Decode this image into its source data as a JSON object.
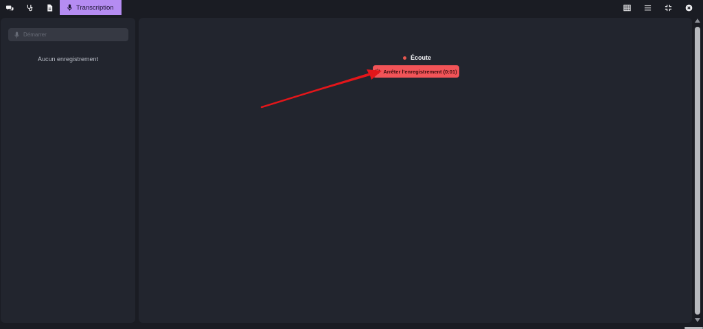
{
  "toolbar": {
    "tabs": [
      {
        "icon": "chat-bubbles-icon"
      },
      {
        "icon": "stethoscope-icon"
      },
      {
        "icon": "document-icon"
      }
    ],
    "active_tab": {
      "icon": "microphone-icon",
      "label": "Transcription"
    },
    "right_icons": [
      "grid-icon",
      "menu-icon",
      "collapse-icon",
      "close-icon"
    ],
    "accent_color": "#b58cf2"
  },
  "sidebar": {
    "start_input": {
      "placeholder": "Démarrer",
      "icon": "microphone-icon"
    },
    "empty_label": "Aucun enregistrement"
  },
  "main": {
    "status_label": "Écoute",
    "status_color": "#e8574f",
    "stop_button": {
      "label": "Arrêter l'enregistrement (0:01)",
      "icon": "spinner-icon",
      "color": "#f25458"
    }
  }
}
